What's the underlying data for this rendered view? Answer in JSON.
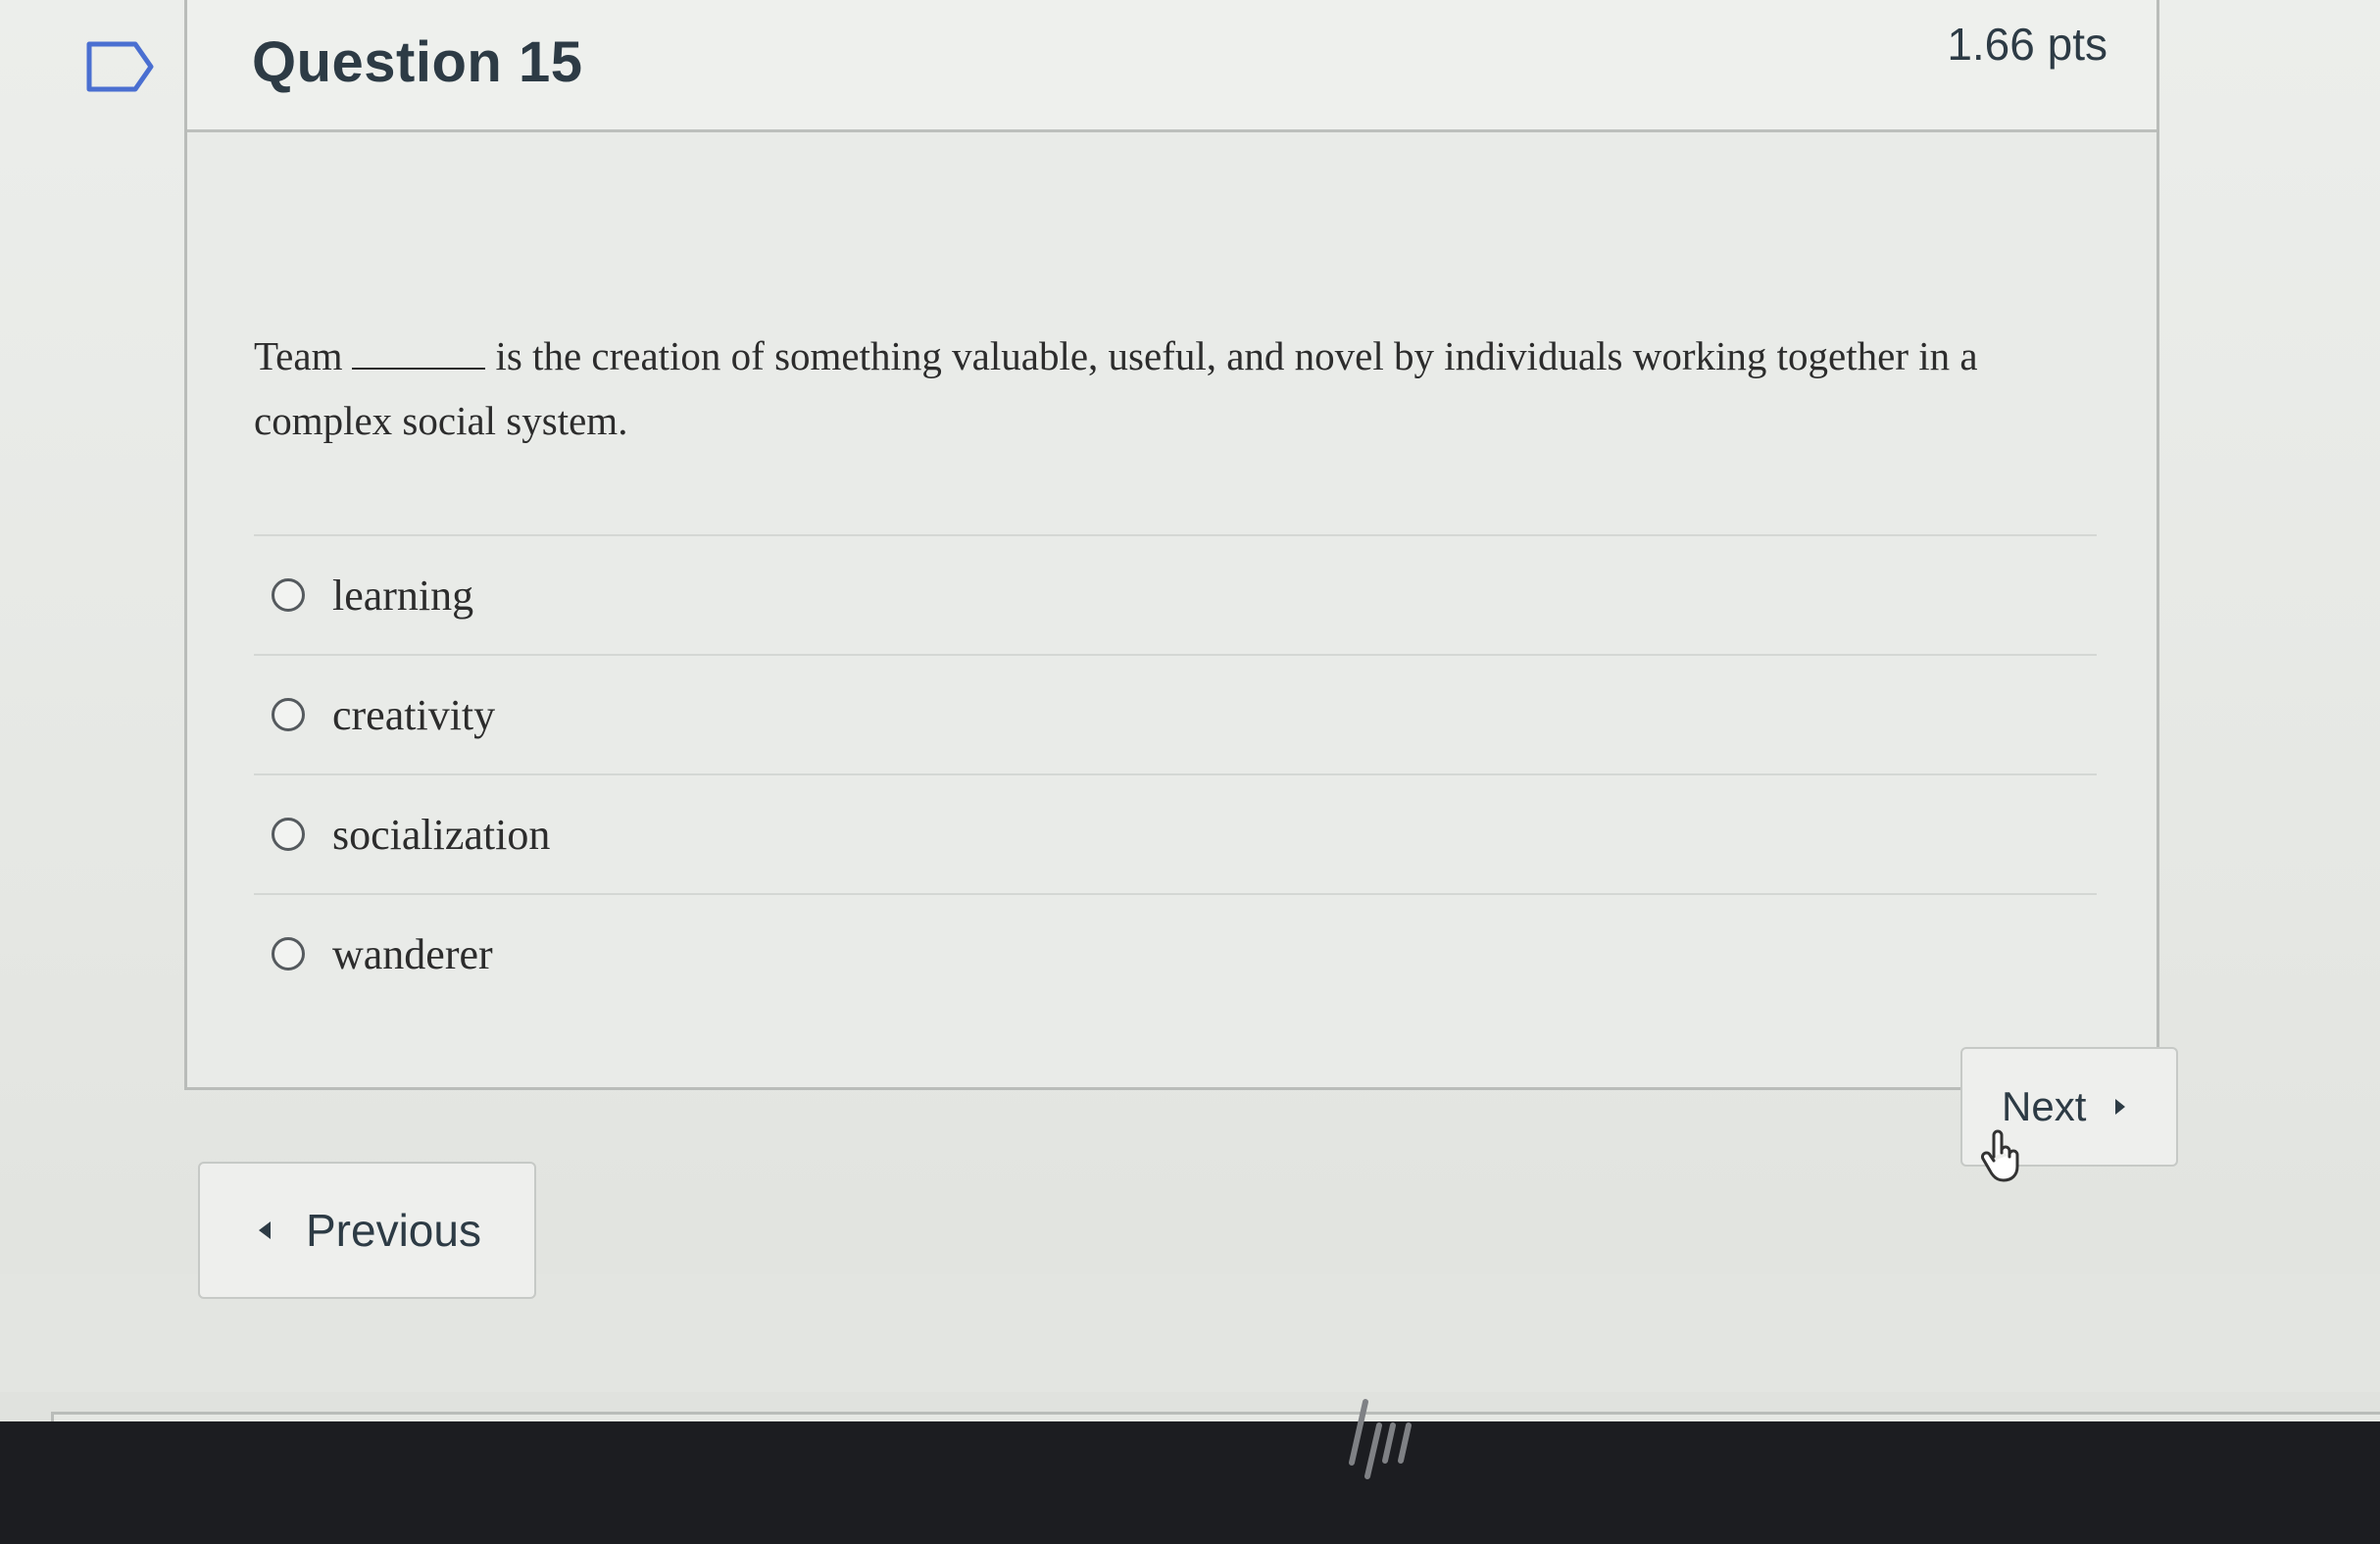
{
  "question": {
    "title": "Question 15",
    "points": "1.66 pts",
    "text_before_blank": "Team",
    "text_after_blank": "is the creation of something valuable, useful, and novel by individuals working together in a complex social system."
  },
  "answers": [
    {
      "label": "learning",
      "selected": false
    },
    {
      "label": "creativity",
      "selected": false
    },
    {
      "label": "socialization",
      "selected": false
    },
    {
      "label": "wanderer",
      "selected": false
    }
  ],
  "navigation": {
    "previous_label": "Previous",
    "next_label": "Next"
  },
  "icons": {
    "flag": "bookmark-flag-icon",
    "prev": "caret-left-icon",
    "next": "caret-right-icon",
    "cursor": "hand-cursor-icon",
    "logo": "hp-logo"
  },
  "colors": {
    "text": "#2d3b45",
    "background": "#e9ebe8",
    "bezel": "#1c1d21"
  }
}
